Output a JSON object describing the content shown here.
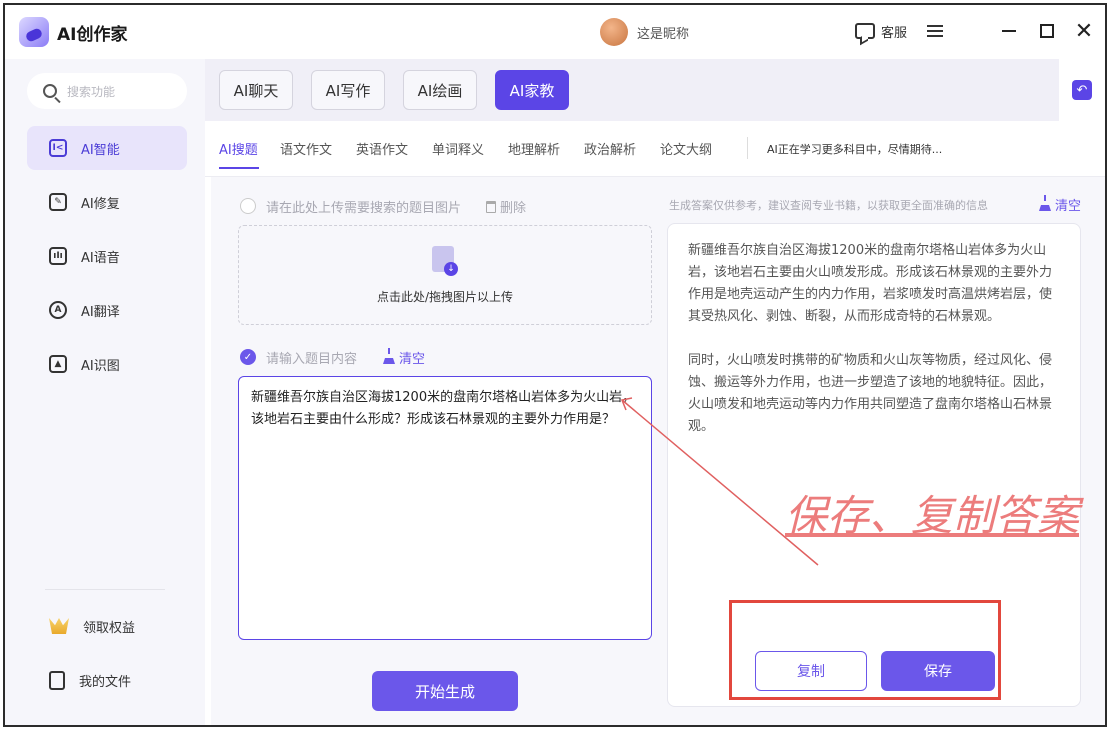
{
  "app": {
    "title": "AI创作家",
    "nickname": "这是昵称",
    "service_label": "客服"
  },
  "sidebar": {
    "search_placeholder": "搜索功能",
    "items": [
      {
        "label": "AI智能",
        "icon": "ai-chip-icon",
        "glyph": "I<"
      },
      {
        "label": "AI修复",
        "icon": "image-repair-icon",
        "glyph": "✎"
      },
      {
        "label": "AI语音",
        "icon": "voice-wave-icon",
        "glyph": "ıIı"
      },
      {
        "label": "AI翻译",
        "icon": "translate-icon",
        "glyph": "A"
      },
      {
        "label": "AI识图",
        "icon": "image-recognize-icon",
        "glyph": "▲"
      }
    ],
    "bottom_items": [
      {
        "label": "领取权益",
        "icon": "crown-icon"
      },
      {
        "label": "我的文件",
        "icon": "file-icon"
      }
    ]
  },
  "top_tabs": [
    "AI聊天",
    "AI写作",
    "AI绘画",
    "AI家教"
  ],
  "sub_tabs": [
    "AI搜题",
    "语文作文",
    "英语作文",
    "单词释义",
    "地理解析",
    "政治解析",
    "论文大纲"
  ],
  "sub_note": "AI正在学习更多科目中，尽情期待...",
  "left": {
    "upload_label": "请在此处上传需要搜索的题目图片",
    "delete_label": "删除",
    "upload_hint": "点击此处/拖拽图片以上传",
    "input_label": "请输入题目内容",
    "clear_label": "清空",
    "question": "新疆维吾尔族自治区海拔1200米的盘南尔塔格山岩体多为火山岩，该地岩石主要由什么形成？形成该石林景观的主要外力作用是？",
    "generate_label": "开始生成"
  },
  "right": {
    "disclaimer": "生成答案仅供参考，建议查阅专业书籍，以获取更全面准确的信息",
    "clear_label": "清空",
    "answer_p1": "新疆维吾尔族自治区海拔1200米的盘南尔塔格山岩体多为火山岩，该地岩石主要由火山喷发形成。形成该石林景观的主要外力作用是地壳运动产生的内力作用，岩浆喷发时高温烘烤岩层，使其受热风化、剥蚀、断裂，从而形成奇特的石林景观。",
    "answer_p2": "同时，火山喷发时携带的矿物质和火山灰等物质，经过风化、侵蚀、搬运等外力作用，也进一步塑造了该地的地貌特征。因此，火山喷发和地壳运动等内力作用共同塑造了盘南尔塔格山石林景观。",
    "copy_label": "复制",
    "save_label": "保存"
  },
  "annotation": {
    "text": "保存、复制答案",
    "color": "#ec7c7c",
    "box_color": "#e2473d"
  },
  "colors": {
    "accent": "#5b45e6",
    "sidebar_active_bg": "#e8e4fb"
  }
}
